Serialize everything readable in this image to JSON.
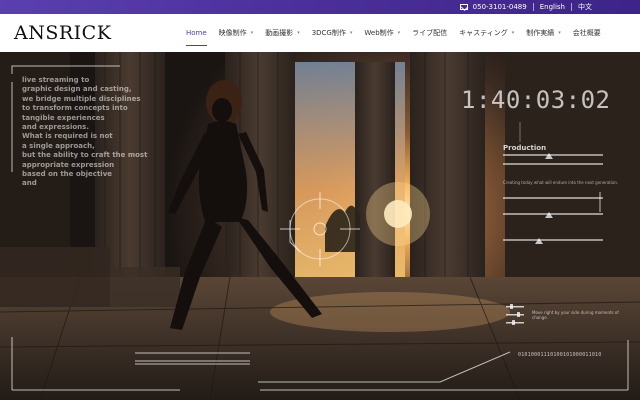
{
  "topbar": {
    "phone": "050-3101-0489",
    "lang_en": "English",
    "lang_zh": "中文"
  },
  "header": {
    "logo": "ANSRICK",
    "nav": [
      {
        "label": "Home",
        "active": true,
        "dropdown": false
      },
      {
        "label": "映像制作",
        "active": false,
        "dropdown": true
      },
      {
        "label": "動画撮影",
        "active": false,
        "dropdown": true
      },
      {
        "label": "3DCG制作",
        "active": false,
        "dropdown": true
      },
      {
        "label": "Web制作",
        "active": false,
        "dropdown": true
      },
      {
        "label": "ライブ配信",
        "active": false,
        "dropdown": false
      },
      {
        "label": "キャスティング",
        "active": false,
        "dropdown": true
      },
      {
        "label": "制作実績",
        "active": false,
        "dropdown": true
      },
      {
        "label": "会社概要",
        "active": false,
        "dropdown": false
      }
    ],
    "accent_color": "#4a3fa8"
  },
  "hero": {
    "text_lines": [
      "live streaming to",
      "graphic design and casting,",
      "we bridge multiple disciplines",
      "to transform concepts into",
      "tangible experiences",
      "and expressions.",
      "What is required is not",
      "a single approach,",
      "but the ability to craft the most",
      "appropriate expression",
      "based on the objective",
      "and"
    ],
    "timecode": "1:40:03:02",
    "production_label": "Production",
    "production_desc": "Creating today what will endure into the next generation.",
    "move_desc": "Move right by your side during moments of change.",
    "binary": "01010001110100101000011010"
  }
}
